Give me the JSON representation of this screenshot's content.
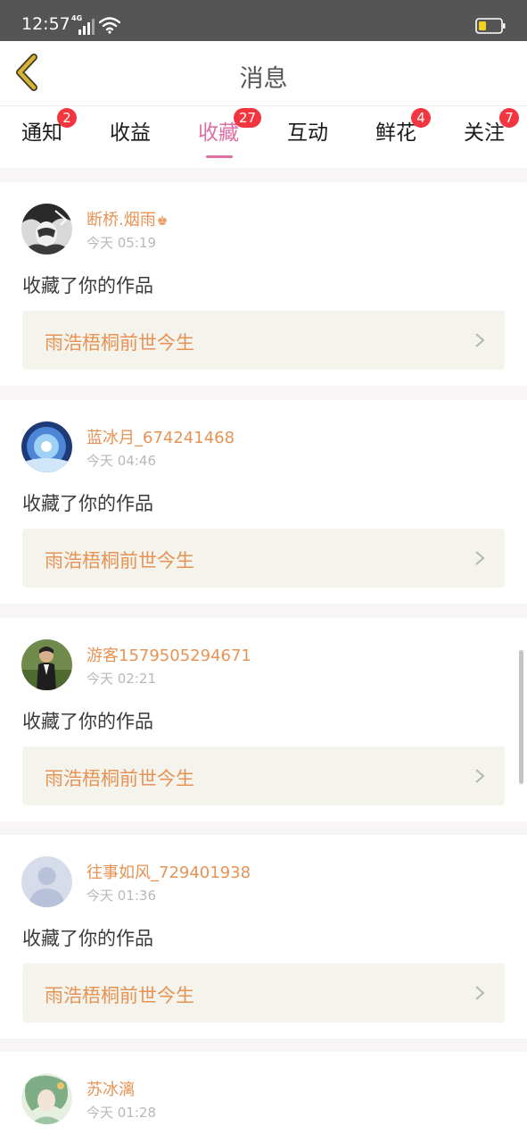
{
  "status_bar": {
    "time": "12:57",
    "network": "4G"
  },
  "header": {
    "title": "消息"
  },
  "tabs": [
    {
      "label": "通知",
      "badge": "2",
      "active": false
    },
    {
      "label": "收益",
      "badge": "",
      "active": false
    },
    {
      "label": "收藏",
      "badge": "27",
      "active": true
    },
    {
      "label": "互动",
      "badge": "",
      "active": false
    },
    {
      "label": "鲜花",
      "badge": "4",
      "active": false
    },
    {
      "label": "关注",
      "badge": "7",
      "active": false
    }
  ],
  "messages": [
    {
      "user": "断桥.烟雨",
      "time": "今天 05:19",
      "action": "收藏了你的作品",
      "work": "雨浩梧桐前世今生"
    },
    {
      "user": "蓝冰月_674241468",
      "time": "今天 04:46",
      "action": "收藏了你的作品",
      "work": "雨浩梧桐前世今生"
    },
    {
      "user": "游客1579505294671",
      "time": "今天 02:21",
      "action": "收藏了你的作品",
      "work": "雨浩梧桐前世今生"
    },
    {
      "user": "往事如风_729401938",
      "time": "今天 01:36",
      "action": "收藏了你的作品",
      "work": "雨浩梧桐前世今生"
    },
    {
      "user": "苏冰漓",
      "time": "今天 01:28",
      "action": "",
      "work": ""
    }
  ],
  "colors": {
    "accent": "#df6fa3",
    "username": "#e69355",
    "badge": "#f2353e",
    "work_bg": "#f4f3ec",
    "back_icon": "#d8b336"
  }
}
